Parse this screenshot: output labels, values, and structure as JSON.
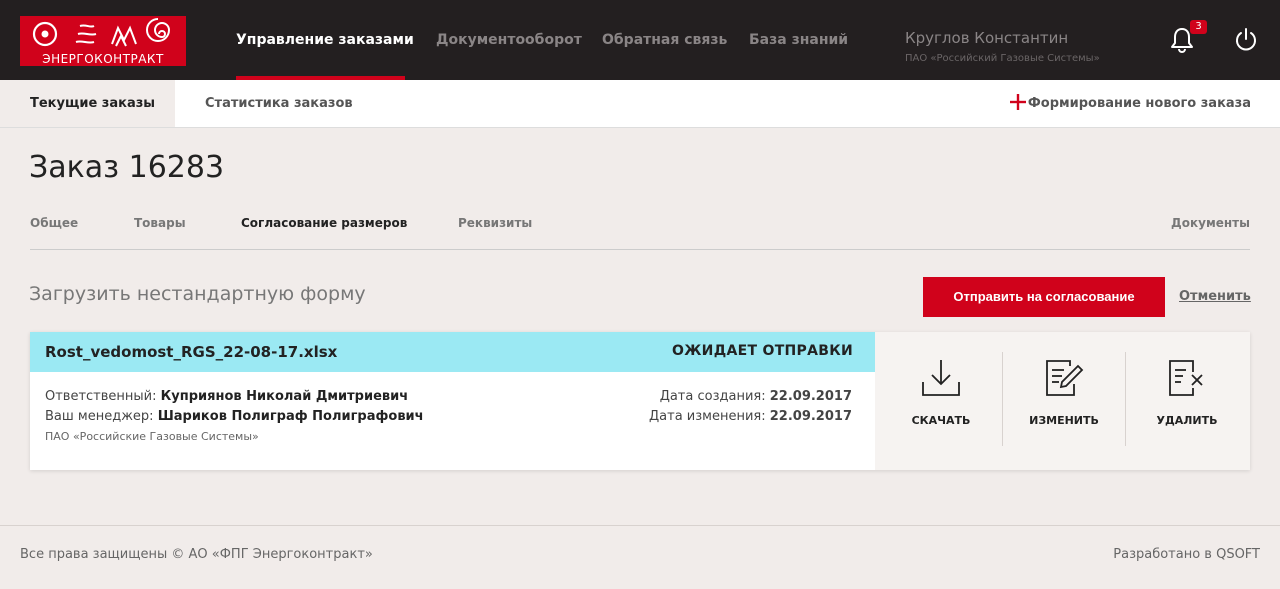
{
  "header": {
    "logo_text": "ЭНЕРГОКОНТРАКТ",
    "nav": [
      {
        "label": "Управление заказами",
        "active": true
      },
      {
        "label": "Документооборот",
        "active": false
      },
      {
        "label": "Обратная связь",
        "active": false
      },
      {
        "label": "База знаний",
        "active": false
      }
    ],
    "user": {
      "name": "Круглов Константин",
      "org": "ПАО «Российский Газовые Системы»"
    },
    "notifications": {
      "count": "3",
      "icon": "bell-icon"
    },
    "power_icon": "power-icon",
    "accent_color": "#d0021b"
  },
  "subnav": {
    "tabs": [
      {
        "label": "Текущие заказы",
        "active": true
      },
      {
        "label": "Статистика заказов",
        "active": false
      }
    ],
    "new_order_label": "Формирование нового заказа",
    "new_order_icon": "plus-icon"
  },
  "page": {
    "title": "Заказ 16283",
    "tabs": [
      {
        "label": "Общее",
        "active": false
      },
      {
        "label": "Товары",
        "active": false
      },
      {
        "label": "Согласование размеров",
        "active": true
      },
      {
        "label": "Реквизиты",
        "active": false
      },
      {
        "label": "Документы",
        "active": false
      }
    ],
    "upload_title": "Загрузить нестандартную форму",
    "send_button": "Отправить на согласование",
    "cancel_link": "Отменить"
  },
  "file_card": {
    "file_name": "Rost_vedomost_RGS_22-08-17.xlsx",
    "status": "ОЖИДАЕТ ОТПРАВКИ",
    "status_color": "#9be9f3",
    "responsible_label": "Ответственный:",
    "responsible_value": "Куприянов Николай Дмитриевич",
    "manager_label": "Ваш менеджер:",
    "manager_value": "Шариков Полиграф Полиграфович",
    "org": "ПАО «Российские Газовые Системы»",
    "created_label": "Дата создания:",
    "created_value": "22.09.2017",
    "modified_label": "Дата изменения:",
    "modified_value": "22.09.2017",
    "actions": [
      {
        "label": "СКАЧАТЬ",
        "icon": "download-icon"
      },
      {
        "label": "ИЗМЕНИТЬ",
        "icon": "edit-document-icon"
      },
      {
        "label": "УДАЛИТЬ",
        "icon": "delete-document-icon"
      }
    ]
  },
  "footer": {
    "copyright": "Все права защищены © АО «ФПГ Энергоконтракт»",
    "developer": "Разработано в QSOFT"
  }
}
